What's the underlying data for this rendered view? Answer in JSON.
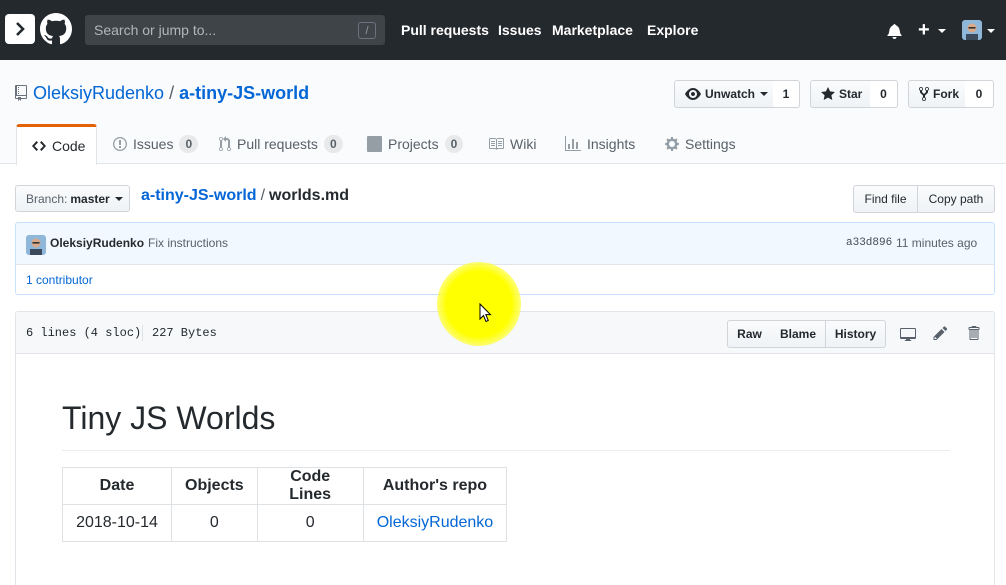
{
  "header": {
    "search_placeholder": "Search or jump to...",
    "search_key": "/",
    "nav": [
      "Pull requests",
      "Issues",
      "Marketplace",
      "Explore"
    ],
    "plus": "+"
  },
  "repo": {
    "owner": "OleksiyRudenko",
    "separator": "/",
    "name": "a-tiny-JS-world",
    "watch_label": "Unwatch",
    "watch_count": "1",
    "star_label": "Star",
    "star_count": "0",
    "fork_label": "Fork",
    "fork_count": "0"
  },
  "tabs": [
    {
      "label": "Code",
      "icon": "code-icon",
      "count": null
    },
    {
      "label": "Issues",
      "icon": "issue-icon",
      "count": "0"
    },
    {
      "label": "Pull requests",
      "icon": "pull-request-icon",
      "count": "0"
    },
    {
      "label": "Projects",
      "icon": "project-icon",
      "count": "0"
    },
    {
      "label": "Wiki",
      "icon": "book-icon",
      "count": null
    },
    {
      "label": "Insights",
      "icon": "graph-icon",
      "count": null
    },
    {
      "label": "Settings",
      "icon": "gear-icon",
      "count": null
    }
  ],
  "file_nav": {
    "branch_label": "Branch:",
    "branch_value": "master",
    "crumb_repo": "a-tiny-JS-world",
    "crumb_sep": "/",
    "crumb_file": "worlds.md",
    "find_file": "Find file",
    "copy_path": "Copy path"
  },
  "commit": {
    "author": "OleksiyRudenko",
    "message": "Fix instructions",
    "sha": "a33d896",
    "time": "11 minutes ago",
    "contributors": "1 contributor"
  },
  "file": {
    "lines_info": "6 lines (4 sloc)",
    "size": "227 Bytes",
    "raw": "Raw",
    "blame": "Blame",
    "history": "History"
  },
  "markdown": {
    "title": "Tiny JS Worlds",
    "table_headers": [
      "Date",
      "Objects",
      "Code Lines",
      "Author's repo"
    ],
    "table_row": [
      "2018-10-14",
      "0",
      "0",
      "OleksiyRudenko"
    ]
  },
  "colors": {
    "header_bg": "#24292e",
    "link": "#0366d6",
    "tab_accent": "#e36209",
    "commit_bg": "#f1f8ff"
  }
}
